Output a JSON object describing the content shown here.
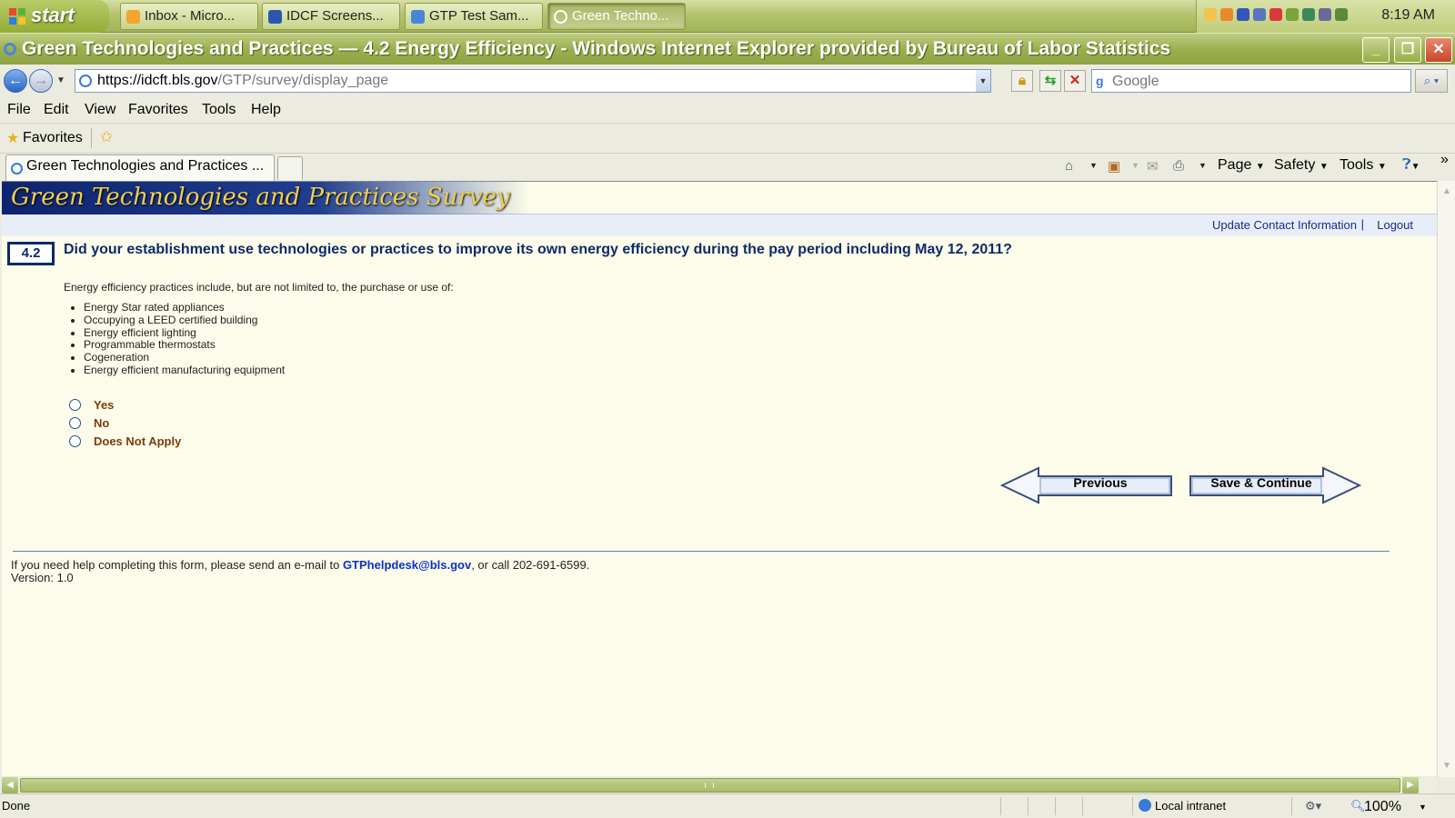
{
  "taskbar": {
    "start_label": "start",
    "tasks": [
      {
        "label": "Inbox - Micro..."
      },
      {
        "label": "IDCF Screens..."
      },
      {
        "label": "GTP Test Sam..."
      },
      {
        "label": "Green Techno..."
      }
    ],
    "clock": "8:19 AM"
  },
  "window": {
    "title": "Green Technologies and Practices — 4.2 Energy Efficiency - Windows Internet Explorer provided by Bureau of Labor Statistics"
  },
  "address_bar": {
    "url_main": "https://idcft.bls.gov",
    "url_path": "/GTP/survey/display_page",
    "search_placeholder": "Google"
  },
  "menu": {
    "items": [
      "File",
      "Edit",
      "View",
      "Favorites",
      "Tools",
      "Help"
    ]
  },
  "favorites_bar": {
    "label": "Favorites"
  },
  "tabs": {
    "active_label": "Green Technologies and Practices ..."
  },
  "command_bar": {
    "page": "Page",
    "safety": "Safety",
    "tools": "Tools"
  },
  "page": {
    "banner_title": "Green Technologies and Practices Survey",
    "update_contact": "Update Contact Information",
    "separator": "|",
    "logout": "Logout",
    "question_number": "4.2",
    "question_text": "Did your establishment use technologies or practices to improve its own energy efficiency during the pay period including May 12, 2011?",
    "intro": "Energy efficiency practices include, but are not limited to, the purchase or use of:",
    "practices": [
      "Energy Star rated appliances",
      "Occupying a LEED certified building",
      "Energy efficient lighting",
      "Programmable thermostats",
      "Cogeneration",
      "Energy efficient manufacturing equipment"
    ],
    "options": [
      "Yes",
      "No",
      "Does Not Apply"
    ],
    "previous_label": "Previous",
    "save_continue_label": "Save & Continue",
    "help_prefix": "If you need help completing this form, please send an e-mail to ",
    "help_email": "GTPhelpdesk@bls.gov",
    "help_suffix": ", or call 202-691-6599.",
    "version": "Version: 1.0"
  },
  "status_bar": {
    "status": "Done",
    "zone": "Local intranet",
    "zoom": "100%"
  },
  "colors": {
    "xp_olive": "#9caf4f",
    "page_bg": "#fdfcea",
    "question_blue": "#0d2a6a",
    "option_brown": "#7a3d0b",
    "banner_gold": "#f0d050"
  }
}
